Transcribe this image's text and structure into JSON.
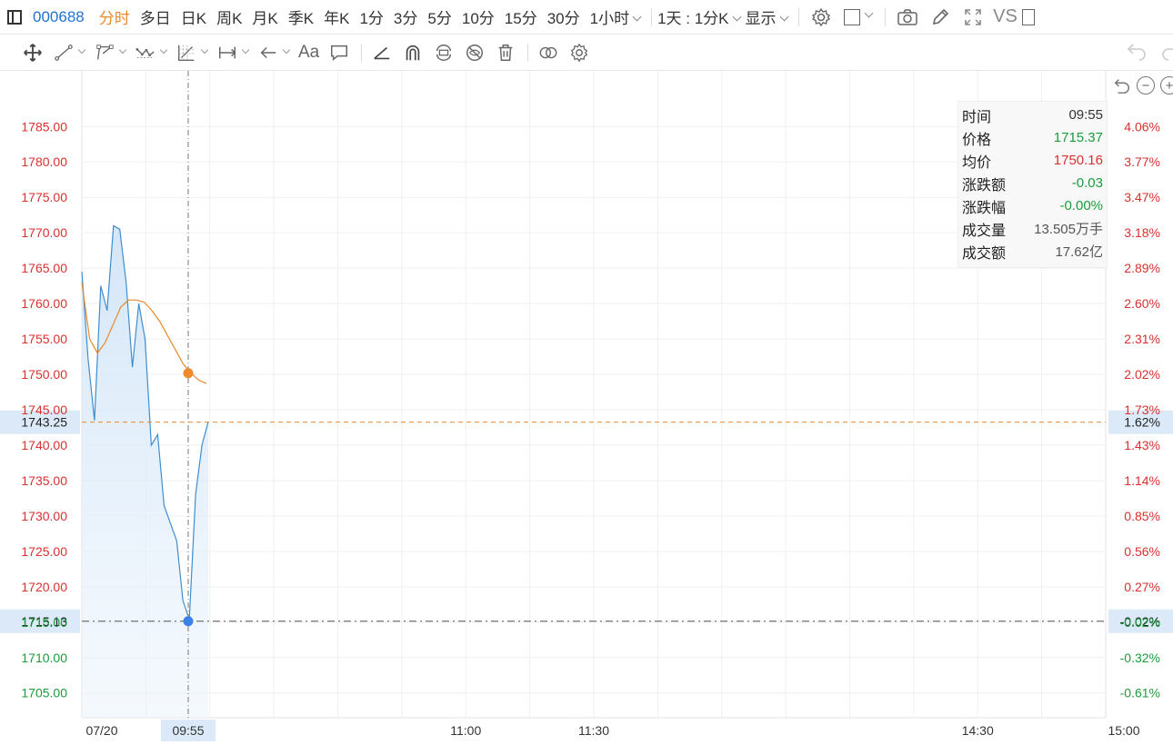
{
  "topbar": {
    "stock_code": "000688",
    "periods": [
      "分时",
      "多日",
      "日K",
      "周K",
      "月K",
      "季K",
      "年K",
      "1分",
      "3分",
      "5分",
      "10分",
      "15分",
      "30分"
    ],
    "hour_dropdown": "1小时",
    "compare_dropdown": "1天 : 1分K",
    "display_dropdown": "显示",
    "right_text": "VS"
  },
  "drawbar": {
    "text_tool": "Aa"
  },
  "info_panel": {
    "rows": [
      {
        "label": "时间",
        "value": "09:55",
        "color": "#333333"
      },
      {
        "label": "价格",
        "value": "1715.37",
        "color": "#1a9c3c"
      },
      {
        "label": "均价",
        "value": "1750.16",
        "color": "#d9312f"
      },
      {
        "label": "涨跌额",
        "value": "-0.03",
        "color": "#1a9c3c"
      },
      {
        "label": "涨跌幅",
        "value": "-0.00%",
        "color": "#1a9c3c"
      },
      {
        "label": "成交量",
        "value": "13.505万手",
        "color": "#555555"
      },
      {
        "label": "成交额",
        "value": "17.62亿",
        "color": "#555555"
      }
    ]
  },
  "colors": {
    "up": "#d9312f",
    "down": "#1a9c3c",
    "price_line": "#3f8ecf",
    "avg_line": "#e58a2e",
    "active_tab": "#e58a2e",
    "code": "#1e73d2"
  },
  "chart_data": {
    "type": "line",
    "left_ticks": [
      "1785.00",
      "1780.00",
      "1775.00",
      "1770.00",
      "1765.00",
      "1760.00",
      "1755.00",
      "1750.00",
      "1745.00",
      "1740.00",
      "1735.00",
      "1730.00",
      "1725.00",
      "1720.00",
      "1715.00",
      "1710.00",
      "1705.00"
    ],
    "right_ticks": [
      "4.06%",
      "3.77%",
      "3.47%",
      "3.18%",
      "2.89%",
      "2.60%",
      "2.31%",
      "2.02%",
      "1.73%",
      "1.43%",
      "1.14%",
      "0.85%",
      "0.56%",
      "0.27%",
      "-0.02%",
      "-0.32%",
      "-0.61%"
    ],
    "tick_values": [
      1785,
      1780,
      1775,
      1770,
      1765,
      1760,
      1755,
      1750,
      1745,
      1740,
      1735,
      1730,
      1725,
      1720,
      1715,
      1710,
      1705
    ],
    "y_range": [
      1701.5,
      1788.5
    ],
    "x_labels": [
      {
        "label": "07/20",
        "minute": 0
      },
      {
        "label": "09:55",
        "minute": 25
      },
      {
        "label": "11:00",
        "minute": 90
      },
      {
        "label": "11:30",
        "minute": 120
      },
      {
        "label": "14:30",
        "minute": 210
      },
      {
        "label": "15:00",
        "minute": 240
      }
    ],
    "total_minutes": 240,
    "base_price": 1715.4,
    "series": [
      {
        "name": "价格",
        "minutes": [
          0,
          1,
          2,
          3,
          4,
          5,
          6,
          7,
          8,
          9,
          10,
          11,
          12,
          13,
          14,
          15,
          16,
          17,
          18,
          19,
          20,
          21,
          22,
          23,
          24,
          25,
          26,
          27,
          28,
          29,
          30
        ],
        "values": [
          1764.5,
          1752.0,
          1743.5,
          1762.5,
          1759.0,
          1771.0,
          1770.5,
          1763.0,
          1751.0,
          1760.0,
          1755.0,
          1740.0,
          1741.5,
          1731.5,
          1729.0,
          1726.5,
          1718.0,
          1715.4,
          1733.0,
          1740.0,
          1743.3
        ]
      },
      {
        "name": "均价",
        "minutes": [
          0,
          1,
          2,
          3,
          4,
          5,
          6,
          7,
          8,
          9,
          10,
          11,
          12,
          13,
          14,
          15,
          16,
          17,
          18,
          19,
          20,
          21,
          22,
          23,
          24,
          25,
          26,
          27,
          28,
          29,
          30
        ],
        "values": [
          1763.0,
          1755.0,
          1753.0,
          1754.5,
          1757.0,
          1759.5,
          1760.5,
          1760.5,
          1760.2,
          1759.0,
          1757.5,
          1755.5,
          1753.5,
          1751.5,
          1750.2,
          1749.2,
          1748.7
        ]
      }
    ],
    "cursor": {
      "time": "09:55",
      "avg": 1750.16,
      "price": 1715.13
    },
    "markers": [
      {
        "label": "1743.25",
        "pct": "1.62%",
        "value": 1743.25,
        "style": "orange-dash"
      },
      {
        "label": "1715.13",
        "pct": "-0.02%",
        "value": 1715.13,
        "style": "gray-dashdot"
      }
    ]
  }
}
